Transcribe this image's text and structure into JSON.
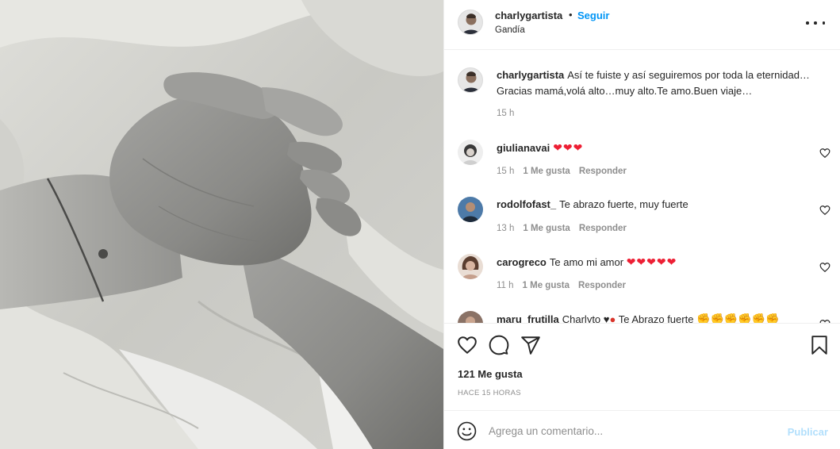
{
  "post": {
    "username": "charlygartista",
    "separator": "•",
    "follow_label": "Seguir",
    "location": "Gandía",
    "caption": {
      "username": "charlygartista",
      "text": "Así te fuiste y así seguiremos por toda la eternidad… Gracias mamá,volá alto…muy alto.Te amo.Buen viaje…",
      "time": "15 h"
    },
    "comments": [
      {
        "username": "giulianavai",
        "text": "",
        "hearts": "❤❤❤",
        "extra": "",
        "time": "15 h",
        "likes": "1 Me gusta",
        "reply": "Responder",
        "avatar_color": "#b9b9b9"
      },
      {
        "username": "rodolfofast_",
        "text": "Te abrazo fuerte, muy fuerte",
        "hearts": "",
        "extra": "",
        "time": "13 h",
        "likes": "1 Me gusta",
        "reply": "Responder",
        "avatar_color": "#5b7fa6"
      },
      {
        "username": "carogreco",
        "text": "Te amo mi amor",
        "hearts": "❤❤❤❤❤",
        "extra": "",
        "time": "11 h",
        "likes": "1 Me gusta",
        "reply": "Responder",
        "avatar_color": "#c9a58e"
      },
      {
        "username": "maru_frutilla",
        "text": "Charlyto",
        "hearts": "",
        "extra": "Te Abrazo fuerte",
        "time": "",
        "likes": "",
        "reply": "",
        "avatar_color": "#8a7266"
      }
    ],
    "likes_count": "121 Me gusta",
    "date": "HACE 15 HORAS",
    "comment_placeholder": "Agrega un comentario...",
    "publish_label": "Publicar"
  },
  "icons": {
    "more": "more-options-icon",
    "like": "heart-icon",
    "comment": "comment-icon",
    "share": "share-icon",
    "save": "bookmark-icon",
    "emoji": "emoji-icon"
  },
  "colors": {
    "link_blue": "#0095f6",
    "publish_disabled": "#b2dffc",
    "secondary_text": "#8e8e8e",
    "heart_red": "#ed1f34"
  }
}
